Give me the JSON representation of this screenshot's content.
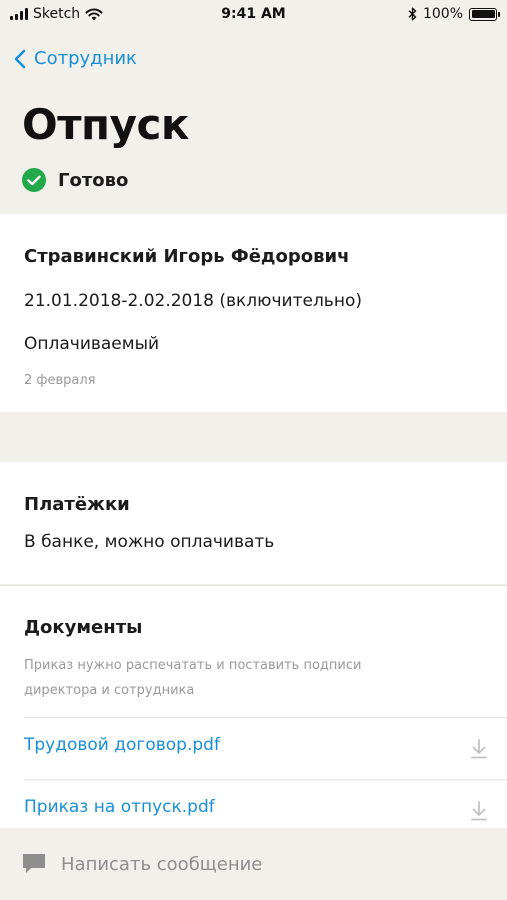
{
  "status_bar": {
    "carrier": "Sketch",
    "time": "9:41 AM",
    "battery": "100%",
    "battery_level": 1.0
  },
  "nav": {
    "back_label": "Сотрудник"
  },
  "header": {
    "title": "Отпуск",
    "status": "Готово"
  },
  "vacation": {
    "employee": "Стравинский Игорь Фёдорович",
    "period": "21.01.2018-2.02.2018 (включительно)",
    "type": "Оплачиваемый",
    "date": "2 февраля"
  },
  "payments": {
    "title": "Платёжки",
    "value": "В банке, можно оплачивать"
  },
  "documents": {
    "title": "Документы",
    "note": "Приказ нужно распечатать и поставить подписи директора и сотрудника",
    "files": [
      {
        "name": "Трудовой договор.pdf",
        "icon": "download-icon"
      },
      {
        "name": "Приказ на отпуск.pdf",
        "icon": "download-icon"
      }
    ]
  },
  "compose": {
    "placeholder": "Написать сообщение",
    "icon": "chat-bubble-icon"
  },
  "colors": {
    "accent": "#1a8fd6",
    "success": "#23a84a",
    "background": "#f1f0eb",
    "muted": "#9a9a9a"
  }
}
